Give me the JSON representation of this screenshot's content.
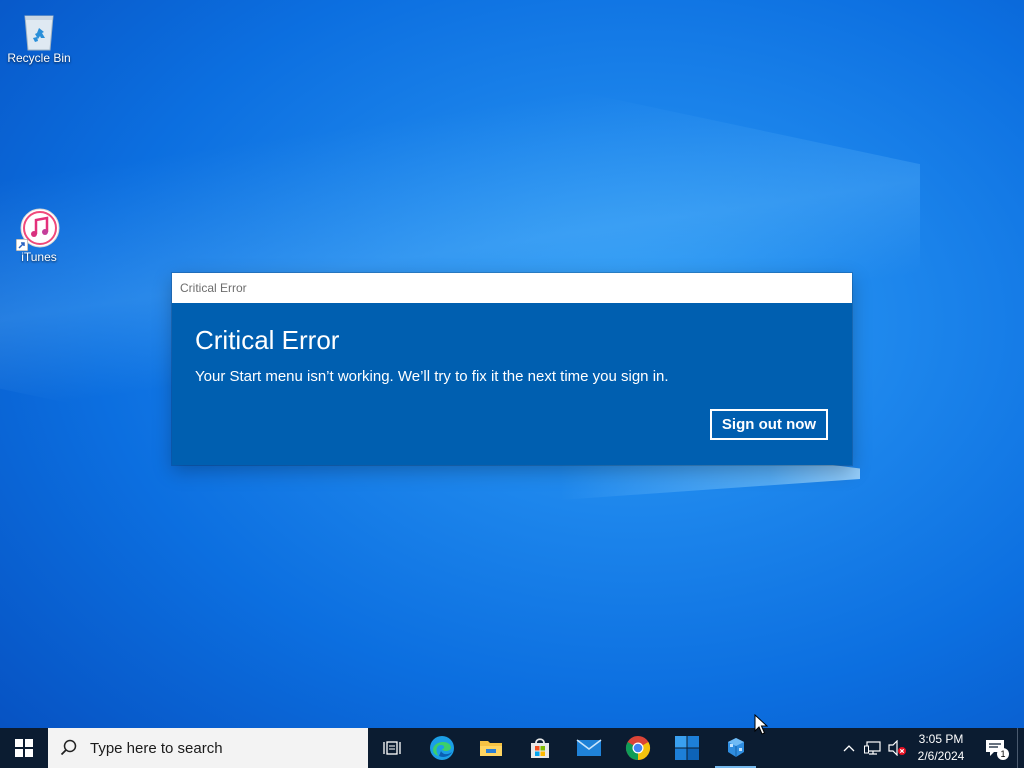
{
  "desktop": {
    "icons": [
      {
        "label": "Recycle Bin",
        "icon": "recycle-bin-icon"
      },
      {
        "label": "iTunes",
        "icon": "itunes-icon"
      }
    ]
  },
  "dialog": {
    "window_title": "Critical Error",
    "heading": "Critical Error",
    "message": "Your Start menu isn’t working. We’ll try to fix it the next time you sign in.",
    "button_label": "Sign out now",
    "bg_color": "#005fb0"
  },
  "taskbar": {
    "search_placeholder": "Type here to search",
    "apps": [
      {
        "name": "task-view",
        "icon": "task-view-icon"
      },
      {
        "name": "edge",
        "icon": "edge-icon"
      },
      {
        "name": "file-explorer",
        "icon": "folder-icon"
      },
      {
        "name": "microsoft-store",
        "icon": "store-icon"
      },
      {
        "name": "mail",
        "icon": "mail-icon"
      },
      {
        "name": "chrome",
        "icon": "chrome-icon"
      },
      {
        "name": "windows-app",
        "icon": "windows-tiles-icon"
      },
      {
        "name": "active-app",
        "icon": "app-cubes-icon",
        "active": true
      }
    ],
    "tray": {
      "time": "3:05 PM",
      "date": "2/6/2024",
      "notification_count": "1"
    }
  }
}
